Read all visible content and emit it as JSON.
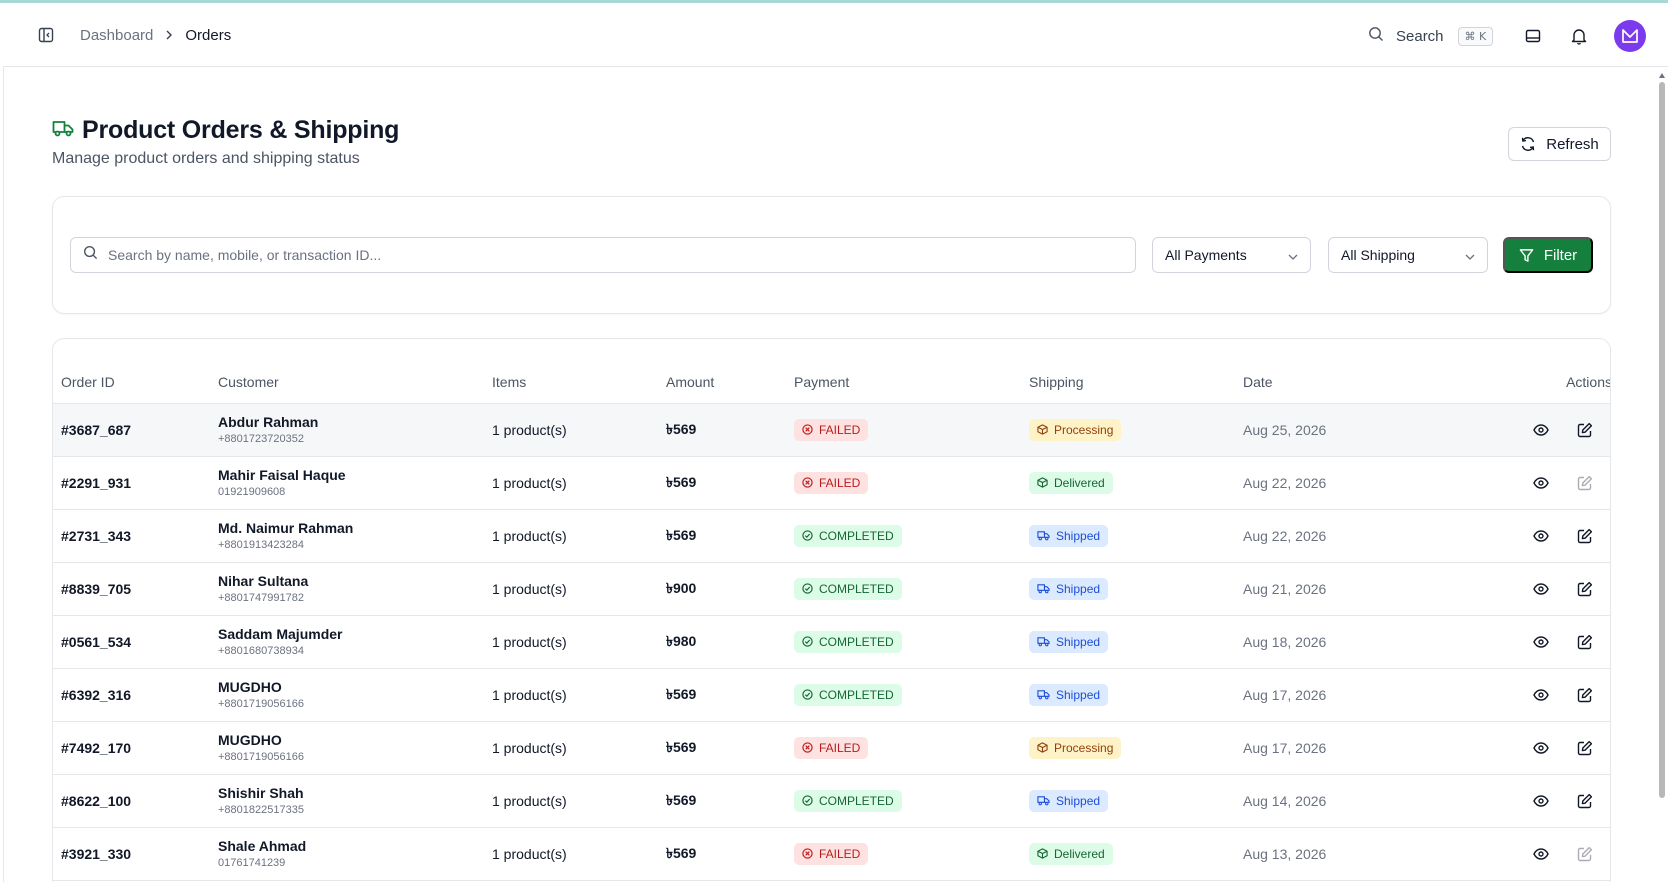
{
  "header": {
    "breadcrumb": [
      {
        "label": "Dashboard"
      },
      {
        "label": "Orders"
      }
    ],
    "search_label": "Search",
    "search_shortcut": "⌘ K",
    "avatar_initial": "M"
  },
  "page": {
    "title": "Product Orders & Shipping",
    "subtitle": "Manage product orders and shipping status",
    "refresh_label": "Refresh"
  },
  "filters": {
    "search_placeholder": "Search by name, mobile, or transaction ID...",
    "payment_select": "All Payments",
    "shipping_select": "All Shipping",
    "filter_label": "Filter"
  },
  "table": {
    "columns": [
      "Order ID",
      "Customer",
      "Items",
      "Amount",
      "Payment",
      "Shipping",
      "Date",
      "Actions"
    ],
    "rows": [
      {
        "id": "#3687_687",
        "name": "Abdur Rahman",
        "phone": "+8801723720352",
        "items": "1 product(s)",
        "amount": "৳569",
        "payment": "FAILED",
        "shipping": "Processing",
        "date": "Aug 25, 2026",
        "edit_enabled": true
      },
      {
        "id": "#2291_931",
        "name": "Mahir Faisal Haque",
        "phone": "01921909608",
        "items": "1 product(s)",
        "amount": "৳569",
        "payment": "FAILED",
        "shipping": "Delivered",
        "date": "Aug 22, 2026",
        "edit_enabled": false
      },
      {
        "id": "#2731_343",
        "name": "Md. Naimur Rahman",
        "phone": "+8801913423284",
        "items": "1 product(s)",
        "amount": "৳569",
        "payment": "COMPLETED",
        "shipping": "Shipped",
        "date": "Aug 22, 2026",
        "edit_enabled": true
      },
      {
        "id": "#8839_705",
        "name": "Nihar Sultana",
        "phone": "+8801747991782",
        "items": "1 product(s)",
        "amount": "৳900",
        "payment": "COMPLETED",
        "shipping": "Shipped",
        "date": "Aug 21, 2026",
        "edit_enabled": true
      },
      {
        "id": "#0561_534",
        "name": "Saddam Majumder",
        "phone": "+8801680738934",
        "items": "1 product(s)",
        "amount": "৳980",
        "payment": "COMPLETED",
        "shipping": "Shipped",
        "date": "Aug 18, 2026",
        "edit_enabled": true
      },
      {
        "id": "#6392_316",
        "name": "MUGDHO",
        "phone": "+8801719056166",
        "items": "1 product(s)",
        "amount": "৳569",
        "payment": "COMPLETED",
        "shipping": "Shipped",
        "date": "Aug 17, 2026",
        "edit_enabled": true
      },
      {
        "id": "#7492_170",
        "name": "MUGDHO",
        "phone": "+8801719056166",
        "items": "1 product(s)",
        "amount": "৳569",
        "payment": "FAILED",
        "shipping": "Processing",
        "date": "Aug 17, 2026",
        "edit_enabled": true
      },
      {
        "id": "#8622_100",
        "name": "Shishir Shah",
        "phone": "+8801822517335",
        "items": "1 product(s)",
        "amount": "৳569",
        "payment": "COMPLETED",
        "shipping": "Shipped",
        "date": "Aug 14, 2026",
        "edit_enabled": true
      },
      {
        "id": "#3921_330",
        "name": "Shale Ahmad",
        "phone": "01761741239",
        "items": "1 product(s)",
        "amount": "৳569",
        "payment": "FAILED",
        "shipping": "Delivered",
        "date": "Aug 13, 2026",
        "edit_enabled": false
      }
    ]
  },
  "colors": {
    "accent": "#15803d",
    "avatar": "#7c3aed",
    "failed": "#b91c1c",
    "completed": "#166534",
    "processing": "#92400e",
    "shipped": "#1d4ed8"
  }
}
